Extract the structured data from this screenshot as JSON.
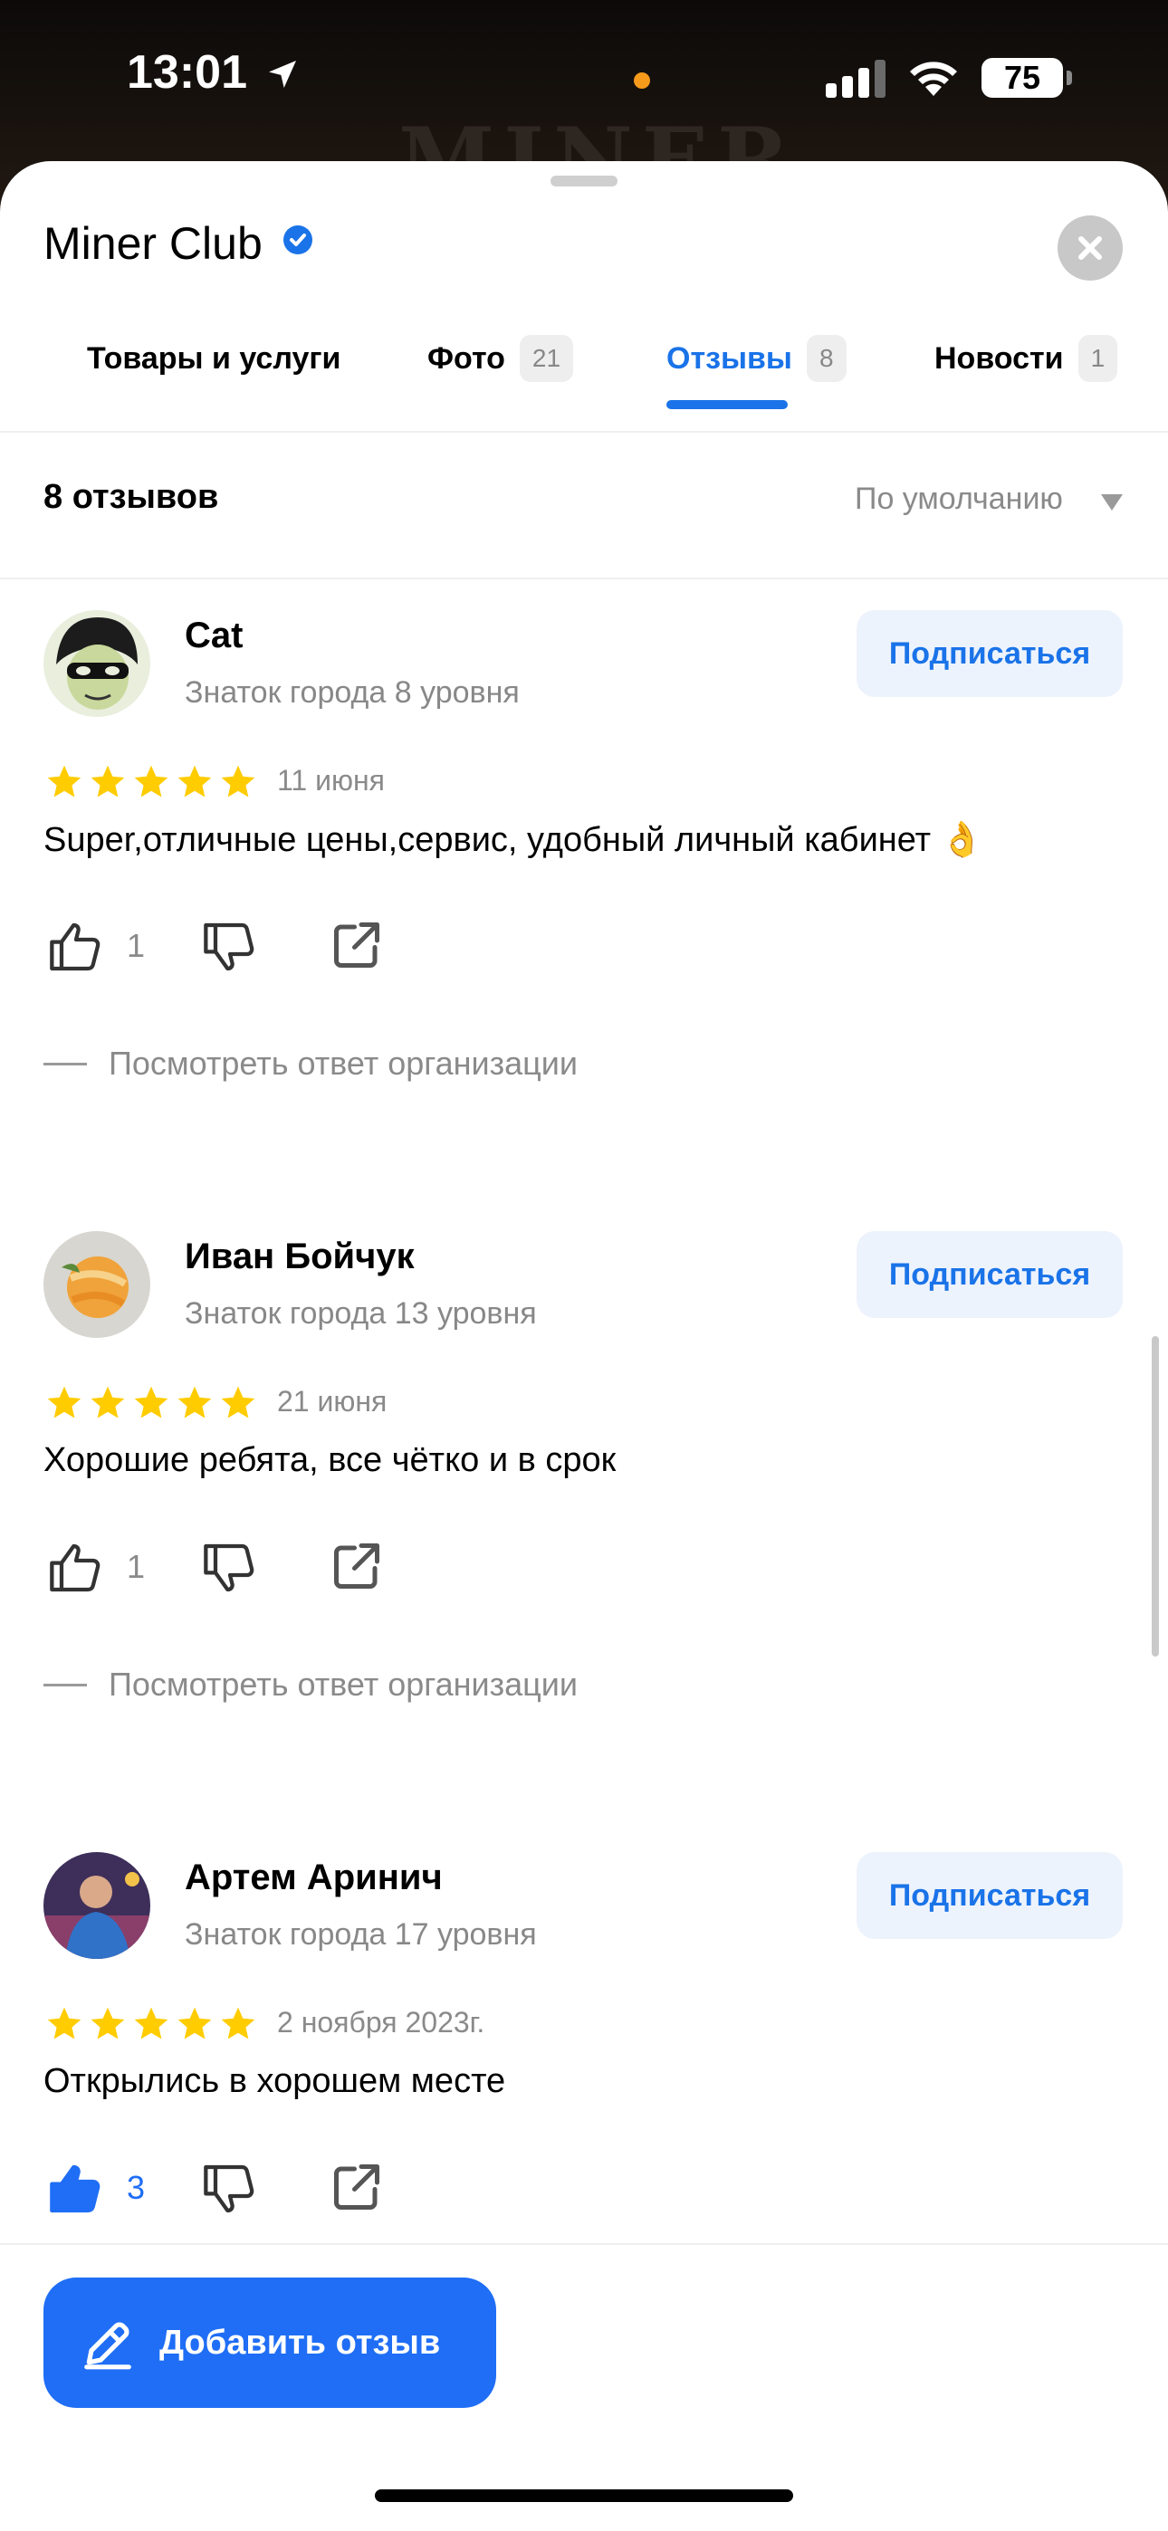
{
  "status": {
    "time": "13:01",
    "battery": "75"
  },
  "background": {
    "logo_text": "MINER"
  },
  "header": {
    "title": "Miner Club"
  },
  "tabs": [
    {
      "label": "Товары и услуги",
      "count": ""
    },
    {
      "label": "Фото",
      "count": "21"
    },
    {
      "label": "Отзывы",
      "count": "8"
    },
    {
      "label": "Новости",
      "count": "1"
    }
  ],
  "reviews_header": {
    "count_label": "8 отзывов",
    "sort_label": "По умолчанию"
  },
  "reviews": [
    {
      "name": "Cat",
      "level": "Знаток города 8 уровня",
      "subscribe": "Подписаться",
      "rating": 5,
      "date": "11 июня",
      "text": "Super,отличные цены,сервис, удобный личный кабинет 👌",
      "likes": "1",
      "liked": false,
      "reply_link": "Посмотреть ответ организации"
    },
    {
      "name": "Иван Бойчук",
      "level": "Знаток города 13 уровня",
      "subscribe": "Подписаться",
      "rating": 5,
      "date": "21 июня",
      "text": "Хорошие ребята, все чётко и в срок",
      "likes": "1",
      "liked": false,
      "reply_link": "Посмотреть ответ организации"
    },
    {
      "name": "Артем Аринич",
      "level": "Знаток города 17 уровня",
      "subscribe": "Подписаться",
      "rating": 5,
      "date": "2 ноября 2023г.",
      "text": "Открылись в хорошем месте",
      "likes": "3",
      "liked": true
    }
  ],
  "add_review": {
    "label": "Добавить отзыв"
  },
  "colors": {
    "accent": "#1a73e8",
    "star": "#ffcc00",
    "button": "#1f6ef5"
  },
  "icons": [
    "location-arrow-icon",
    "signal-icon",
    "wifi-icon",
    "battery-icon",
    "verified-icon",
    "close-icon",
    "chevron-down-icon",
    "star-icon",
    "thumbs-up-icon",
    "thumbs-down-icon",
    "share-icon",
    "pencil-icon"
  ]
}
